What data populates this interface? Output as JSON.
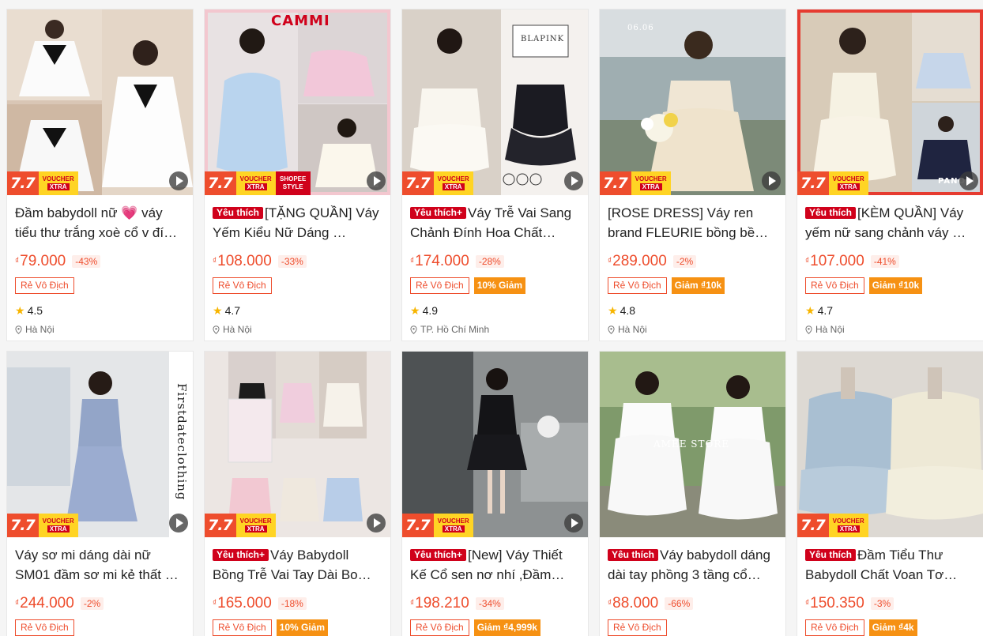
{
  "colors": {
    "accent": "#ee4d2d",
    "favorite": "#d0011b",
    "voucher_yellow": "#ffd424",
    "promo_orange": "#f69113",
    "star": "#f7b500"
  },
  "badges": {
    "sale_label": "7.7",
    "voucher_label": "VOUCHER",
    "xtra_label": "XTRA",
    "style_label": "SHOPEE STYLE",
    "currency": "₫"
  },
  "products": [
    {
      "title": "Đầm babydoll nữ 💗 váy tiểu thư trắng xoè cổ v đí…",
      "favorite": "",
      "price": "79.000",
      "discount": "-43%",
      "tag": "Rẻ Vô Địch",
      "promo": "",
      "rating": "4.5",
      "location": "Hà Nội",
      "overlay": ""
    },
    {
      "title": "[TẶNG QUẦN] Váy Yếm Kiểu Nữ Dáng …",
      "favorite": "Yêu thích",
      "price": "108.000",
      "discount": "-33%",
      "tag": "Rẻ Vô Địch",
      "promo": "",
      "rating": "4.7",
      "location": "Hà Nội",
      "overlay": "CAMMI"
    },
    {
      "title": "Váy Trễ Vai Sang Chảnh Đính Hoa Chất…",
      "favorite": "Yêu thích+",
      "price": "174.000",
      "discount": "-28%",
      "tag": "Rẻ Vô Địch",
      "promo": "10% Giảm",
      "rating": "4.9",
      "location": "TP. Hồ Chí Minh",
      "overlay": "BLAPINK"
    },
    {
      "title": "[ROSE DRESS] Váy ren brand FLEURIE bồng bề…",
      "favorite": "",
      "price": "289.000",
      "discount": "-2%",
      "tag": "Rẻ Vô Địch",
      "promo": "Giảm ₫10k",
      "rating": "4.8",
      "location": "Hà Nội",
      "overlay": "06.06"
    },
    {
      "title": "[KÈM QUẦN] Váy yếm nữ sang chảnh váy …",
      "favorite": "Yêu thích",
      "price": "107.000",
      "discount": "-41%",
      "tag": "Rẻ Vô Địch",
      "promo": "Giảm ₫10k",
      "rating": "4.7",
      "location": "Hà Nội",
      "overlay": "PANOSI"
    },
    {
      "title": "Váy sơ mi dáng dài nữ SM01 đầm sơ mi kẻ thất …",
      "favorite": "",
      "price": "244.000",
      "discount": "-2%",
      "tag": "Rẻ Vô Địch",
      "promo": "",
      "overlay": "Firstdateclothing"
    },
    {
      "title": "Váy Babydoll Bồng Trễ Vai Tay Dài Bo…",
      "favorite": "Yêu thích+",
      "price": "165.000",
      "discount": "-18%",
      "tag": "Rẻ Vô Địch",
      "promo": "10% Giảm",
      "overlay": ""
    },
    {
      "title": "[New] Váy Thiết Kế Cổ sen nơ nhí ,Đầm…",
      "favorite": "Yêu thích+",
      "price": "198.210",
      "discount": "-34%",
      "tag": "Rẻ Vô Địch",
      "promo": "Giảm ₫4,999k",
      "overlay": ""
    },
    {
      "title": "Váy babydoll dáng dài tay phồng 3 tầng cổ…",
      "favorite": "Yêu thích",
      "price": "88.000",
      "discount": "-66%",
      "tag": "Rẻ Vô Địch",
      "promo": "",
      "overlay": "AMEE STORE"
    },
    {
      "title": "Đầm Tiểu Thư Babydoll Chất Voan Tơ…",
      "favorite": "Yêu thích",
      "price": "150.350",
      "discount": "-3%",
      "tag": "Rẻ Vô Địch",
      "promo": "Giảm ₫4k",
      "overlay": ""
    }
  ]
}
